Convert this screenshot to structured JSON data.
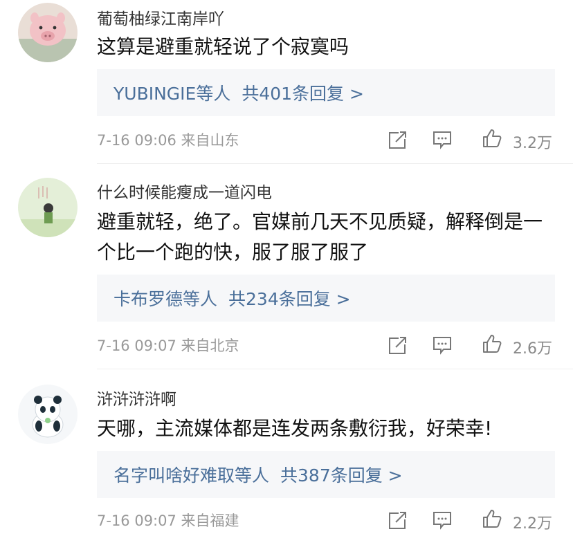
{
  "comments": [
    {
      "username": "葡萄柚绿江南岸吖",
      "text": "这算是避重就轻说了个寂寞吗",
      "reply_users": "YUBINGIE等人",
      "reply_count": "共401条回复 >",
      "time_location": "7-16 09:06 来自山东",
      "likes": "3.2万"
    },
    {
      "username": "什么时候能瘦成一道闪电",
      "text": "避重就轻，绝了。官媒前几天不见质疑，解释倒是一个比一个跑的快，服了服了服了",
      "reply_users": "卡布罗德等人",
      "reply_count": "共234条回复 >",
      "time_location": "7-16 09:07 来自北京",
      "likes": "2.6万"
    },
    {
      "username": "浒浒浒浒啊",
      "text": "天哪，主流媒体都是连发两条敷衍我，好荣幸!",
      "reply_users": "名字叫啥好难取等人",
      "reply_count": "共387条回复 >",
      "time_location": "7-16 09:07 来自福建",
      "likes": "2.2万"
    }
  ],
  "colors": {
    "link": "#4a6f9a",
    "reply_bg": "#f6f7f9",
    "meta": "#999999"
  }
}
